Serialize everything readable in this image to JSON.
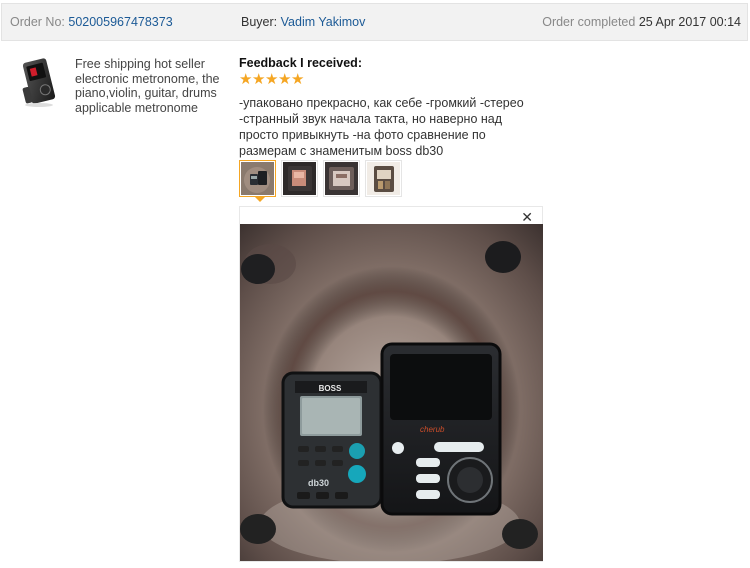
{
  "order": {
    "label": "Order No:",
    "number": "502005967478373"
  },
  "buyer": {
    "label": "Buyer:",
    "name": "Vadim Yakimov"
  },
  "status": {
    "label": "Order completed",
    "date": "25 Apr 2017 00:14"
  },
  "product": {
    "title": "Free shipping hot seller electronic metronome, the piano,violin, guitar, drums applicable metronome"
  },
  "feedback": {
    "heading": "Feedback I received:",
    "rating": 5,
    "text": "-упаковано прекрасно, как себе -громкий -стерео -странный звук начала такта, но наверно над просто привыкнуть -на фото сравнение по размерам с знаменитым boss db30"
  },
  "photo_labels": {
    "boss_brand": "BOSS",
    "boss_model": "db30",
    "cherub_brand": "cherub"
  },
  "colors": {
    "link": "#1c5a96",
    "star": "#f5a623",
    "header_bg": "#f2f2f2"
  },
  "icons": {
    "close": "close-icon",
    "star": "star-icon"
  }
}
